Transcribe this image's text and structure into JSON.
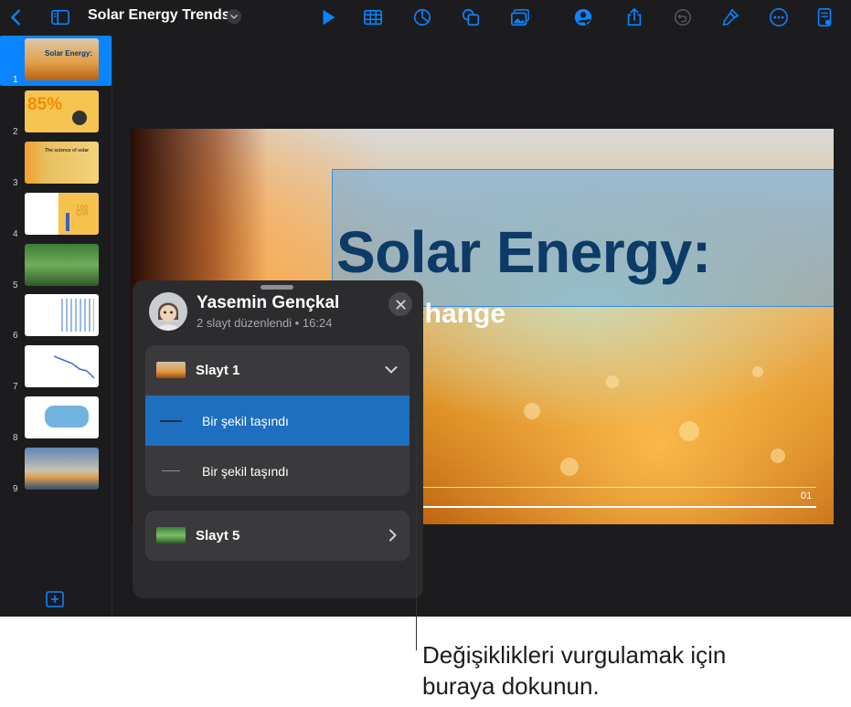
{
  "toolbar": {
    "title": "Solar Energy Trends",
    "icons": [
      "back-icon",
      "sidebar-icon",
      "play-icon",
      "table-icon",
      "chart-icon",
      "shape-icon",
      "media-icon",
      "collaborate-icon",
      "share-icon",
      "undo-icon",
      "format-icon",
      "more-icon",
      "document-icon"
    ]
  },
  "navigator": {
    "slides": [
      {
        "number": "1",
        "text": "Solar Energy:",
        "selected": true
      },
      {
        "number": "2",
        "text": "85%"
      },
      {
        "number": "3",
        "text": "The science of solar"
      },
      {
        "number": "4",
        "text": "100 GW"
      },
      {
        "number": "5",
        "text": ""
      },
      {
        "number": "6",
        "text": ""
      },
      {
        "number": "7",
        "text": ""
      },
      {
        "number": "8",
        "text": ""
      },
      {
        "number": "9",
        "text": ""
      }
    ]
  },
  "slide": {
    "title": "Solar Energy:",
    "subtitle": "ring change",
    "page_number": "01"
  },
  "popover": {
    "user_name": "Yasemin Gençkal",
    "user_subtitle": "2 slayt düzenlendi • 16:24",
    "groups": [
      {
        "label": "Slayt 1",
        "expanded": true,
        "changes": [
          {
            "label": "Bir şekil taşındı",
            "highlighted": true
          },
          {
            "label": "Bir şekil taşındı",
            "highlighted": false
          }
        ]
      },
      {
        "label": "Slayt 5",
        "expanded": false
      }
    ]
  },
  "callout": {
    "text": "Değişiklikleri vurgulamak için buraya dokunun."
  },
  "colors": {
    "accent": "#0a84ff",
    "highlight_row": "#1f6fbf",
    "slide_title": "#0e3a66"
  }
}
